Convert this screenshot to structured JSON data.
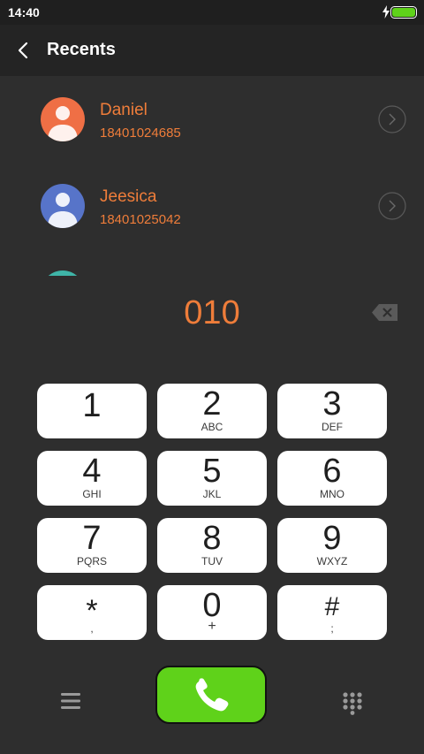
{
  "status_bar": {
    "time": "14:40"
  },
  "header": {
    "title": "Recents",
    "back_icon": "chevron-left-icon"
  },
  "recents": [
    {
      "name": "Daniel",
      "number": "18401024685",
      "avatar_color": "#ef6f45"
    },
    {
      "name": "Jeesica",
      "number": "18401025042",
      "avatar_color": "#5774c9"
    }
  ],
  "dialer": {
    "number": "010"
  },
  "keypad": [
    {
      "digit": "1",
      "letters": ""
    },
    {
      "digit": "2",
      "letters": "ABC"
    },
    {
      "digit": "3",
      "letters": "DEF"
    },
    {
      "digit": "4",
      "letters": "GHI"
    },
    {
      "digit": "5",
      "letters": "JKL"
    },
    {
      "digit": "6",
      "letters": "MNO"
    },
    {
      "digit": "7",
      "letters": "PQRS"
    },
    {
      "digit": "8",
      "letters": "TUV"
    },
    {
      "digit": "9",
      "letters": "WXYZ"
    },
    {
      "digit": "*",
      "letters": ","
    },
    {
      "digit": "0",
      "letters": "+"
    },
    {
      "digit": "#",
      "letters": ";"
    }
  ],
  "colors": {
    "accent": "#ef7d3a",
    "call_button": "#5fd21a",
    "background": "#2e2e2e",
    "battery": "#5fd21a"
  }
}
